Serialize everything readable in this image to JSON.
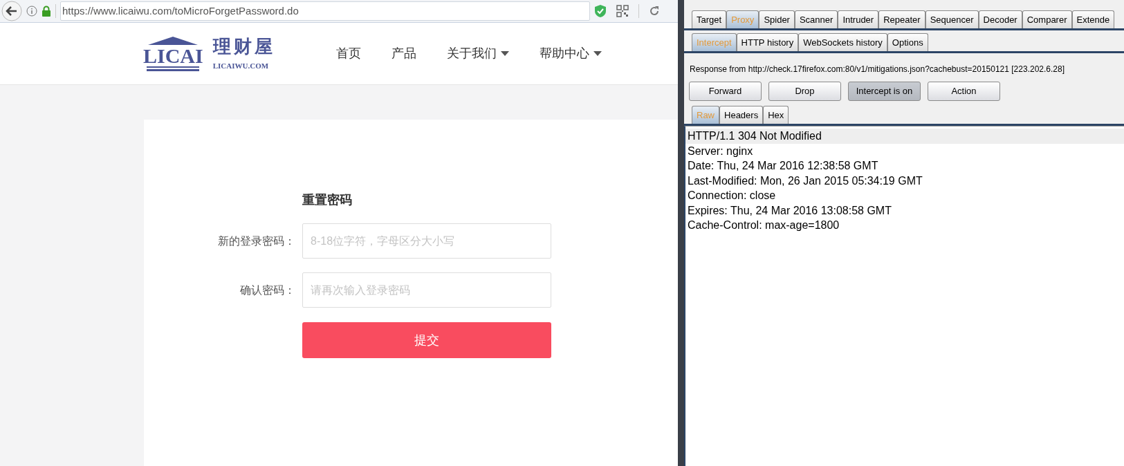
{
  "browser": {
    "url": "https://www.licaiwu.com/toMicroForgetPassword.do",
    "logo": {
      "mark": "LICAI",
      "name": "理财屋",
      "domain": "LICAIWU.COM"
    },
    "nav": [
      {
        "label": "首页",
        "dropdown": false
      },
      {
        "label": "产品",
        "dropdown": false
      },
      {
        "label": "关于我们",
        "dropdown": true
      },
      {
        "label": "帮助中心",
        "dropdown": true
      }
    ],
    "form": {
      "title": "重置密码",
      "fields": [
        {
          "label": "新的登录密码：",
          "placeholder": "8-18位字符，字母区分大小写"
        },
        {
          "label": "确认密码：",
          "placeholder": "请再次输入登录密码"
        }
      ],
      "submit": "提交"
    }
  },
  "burp": {
    "tabs": [
      {
        "label": "Target",
        "selected": false
      },
      {
        "label": "Proxy",
        "selected": true
      },
      {
        "label": "Spider",
        "selected": false
      },
      {
        "label": "Scanner",
        "selected": false
      },
      {
        "label": "Intruder",
        "selected": false
      },
      {
        "label": "Repeater",
        "selected": false
      },
      {
        "label": "Sequencer",
        "selected": false
      },
      {
        "label": "Decoder",
        "selected": false
      },
      {
        "label": "Comparer",
        "selected": false
      },
      {
        "label": "Extende",
        "selected": false
      }
    ],
    "sub_tabs": [
      {
        "label": "Intercept",
        "selected": true
      },
      {
        "label": "HTTP history",
        "selected": false
      },
      {
        "label": "WebSockets history",
        "selected": false
      },
      {
        "label": "Options",
        "selected": false
      }
    ],
    "response_from": "Response from http://check.17firefox.com:80/v1/mitigations.json?cachebust=20150121  [223.202.6.28]",
    "buttons": [
      {
        "label": "Forward",
        "pressed": false
      },
      {
        "label": "Drop",
        "pressed": false
      },
      {
        "label": "Intercept is on",
        "pressed": true
      },
      {
        "label": "Action",
        "pressed": false
      }
    ],
    "view_tabs": [
      {
        "label": "Raw",
        "selected": true
      },
      {
        "label": "Headers",
        "selected": false
      },
      {
        "label": "Hex",
        "selected": false
      }
    ],
    "response_lines": [
      {
        "text": "HTTP/1.1 304 Not Modified",
        "current": true
      },
      {
        "text": "Server: nginx",
        "current": false
      },
      {
        "text": "Date: Thu, 24 Mar 2016 12:38:58 GMT",
        "current": false
      },
      {
        "text": "Last-Modified: Mon, 26 Jan 2015 05:34:19 GMT",
        "current": false
      },
      {
        "text": "Connection: close",
        "current": false
      },
      {
        "text": "Expires: Thu, 24 Mar 2016 13:08:58 GMT",
        "current": false
      },
      {
        "text": "Cache-Control: max-age=1800",
        "current": false
      }
    ]
  }
}
